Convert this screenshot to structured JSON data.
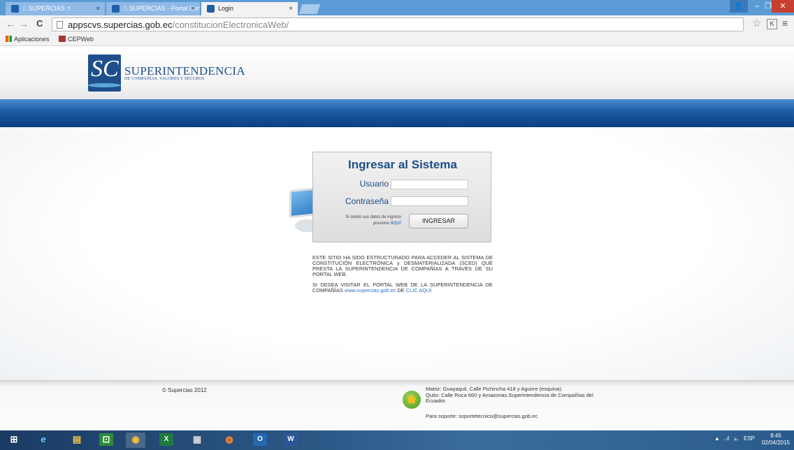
{
  "browser": {
    "tabs": [
      {
        "label": "⎍ SUPERCIAS :t",
        "active": false
      },
      {
        "label": "⎍ SUPERCIAS - Portal Con",
        "active": false
      },
      {
        "label": "Login",
        "active": true
      }
    ],
    "tab_close_glyph": "×",
    "window_controls": {
      "user": "👤",
      "minimize": "–",
      "maximize": "❐",
      "close": "✕"
    },
    "nav": {
      "back": "←",
      "forward": "→",
      "reload": "C"
    },
    "url_host": "appscvs.supercias.gob.ec",
    "url_path": "/constitucionElectronicaWeb/",
    "star": "☆",
    "ext_label": "K",
    "menu": "≡",
    "bookmarks": [
      {
        "label": "Aplicaciones",
        "icon": "apps-icon"
      },
      {
        "label": "CEPWeb",
        "icon": "cepweb-icon"
      }
    ]
  },
  "header": {
    "logo_letters": "SC",
    "logo_title": "SUPERINTENDENCIA",
    "logo_subtitle": "DE COMPAÑÍAS, VALORES Y SEGUROS"
  },
  "login": {
    "title": "Ingresar al Sistema",
    "user_label": "Usuario",
    "password_label": "Contraseña",
    "user_value": "",
    "password_value": "",
    "forgot_text": "Si olvidó sus datos de ingreso presione",
    "forgot_link": "aquí",
    "submit_label": "INGRESAR"
  },
  "info": {
    "paragraph1": "ESTE SITIO HA SIDO ESTRUCTURADO PARA ACCEDER AL SISTEMA DE CONSTITUCIÓN ELECTRÓNICA y DESMATERIALIZADA (SCED) QUE PRESTA LA SUPERINTENDENCIA DE COMPAÑÍAS A TRAVÉS DE SU PORTAL WEB.",
    "paragraph2_prefix": "SI DESEA VISITAR EL PORTAL WEB DE LA SUPERINTENDENCIA DE COMPAÑÍAS",
    "portal_link": "www.supercias.gob.ec",
    "paragraph2_mid": "DE",
    "click_link": "CLIC AQUÍ"
  },
  "footer": {
    "copyright": "© Supercias 2012",
    "address_line1": "Matriz: Guayaquil, Calle Pichincha 418 y Aguirre (esquina).",
    "address_line2": "Quito: Calle Roca 660 y Amazonas.Superintendencia de Compañías del Ecuador.",
    "support": "Para soporte: soportetecnico@supercias.gob.ec"
  },
  "taskbar": {
    "apps": [
      {
        "name": "windows-start-icon",
        "glyph": "⊞"
      },
      {
        "name": "internet-explorer-icon",
        "glyph": "e"
      },
      {
        "name": "file-explorer-icon",
        "glyph": "▤"
      },
      {
        "name": "store-icon",
        "glyph": "⊡"
      },
      {
        "name": "chrome-icon",
        "glyph": "◉"
      },
      {
        "name": "excel-icon",
        "glyph": "X"
      },
      {
        "name": "calculator-icon",
        "glyph": "▦"
      },
      {
        "name": "firefox-icon",
        "glyph": "◍"
      },
      {
        "name": "outlook-icon",
        "glyph": "O"
      },
      {
        "name": "word-icon",
        "glyph": "W"
      }
    ],
    "tray_arrow": "▲",
    "signal": "..ıl",
    "volume": "🔈",
    "language": "ESP",
    "time": "8:45",
    "date": "02/04/2015"
  },
  "colors": {
    "brand_blue": "#1d4f86",
    "tab_bar": "#5b9bd5",
    "link": "#2b70c9"
  }
}
